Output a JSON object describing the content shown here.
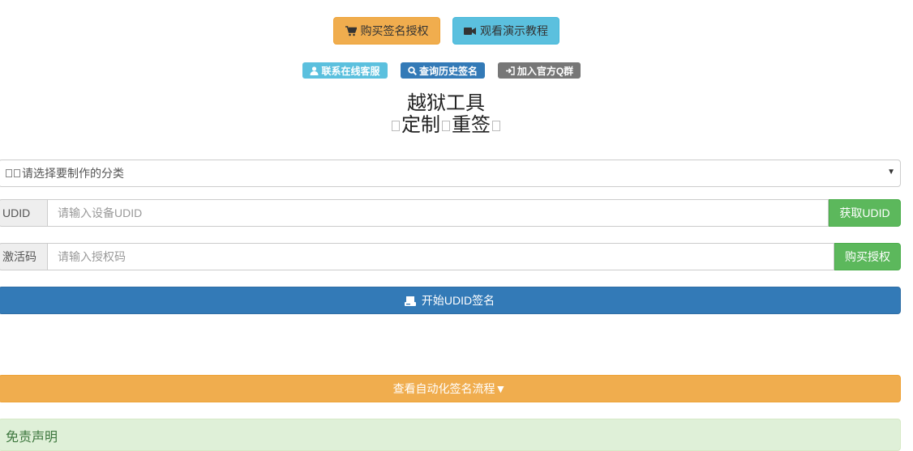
{
  "top_buttons": {
    "buy_signature": "购买签名授权",
    "watch_tutorial": "观看演示教程"
  },
  "badges": {
    "contact": "联系在线客服",
    "history": "查询历史签名",
    "qq_group": "加入官方Q群"
  },
  "title": {
    "line1": "越狱工具",
    "part1": "定制",
    "part2": "重签"
  },
  "category_select": {
    "value": "请选择要制作的分类"
  },
  "udid_row": {
    "label": "UDID",
    "placeholder": "请输入设备UDID",
    "button": "获取UDID"
  },
  "code_row": {
    "label": "激活码",
    "placeholder": "请输入授权码",
    "button": "购买授权"
  },
  "start_button": "开始UDID签名",
  "flow_button": "查看自动化签名流程▼",
  "disclaimer": {
    "title": "免责声明"
  },
  "colors": {
    "orange": "#f0ad4e",
    "info": "#5bc0de",
    "primary": "#337ab7",
    "success": "#5cb85c",
    "dark_gray": "#777777",
    "badge_blue": "#337ab7"
  }
}
